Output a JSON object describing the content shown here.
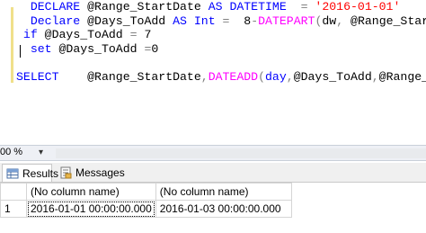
{
  "editor": {
    "lines": [
      [
        {
          "c": "pl",
          "t": "  "
        },
        {
          "c": "kw",
          "t": "DECLARE"
        },
        {
          "c": "pl",
          "t": " @Range_StartDate "
        },
        {
          "c": "kw",
          "t": "AS"
        },
        {
          "c": "pl",
          "t": " "
        },
        {
          "c": "kw",
          "t": "DATETIME"
        },
        {
          "c": "pl",
          "t": "  "
        },
        {
          "c": "op",
          "t": "="
        },
        {
          "c": "pl",
          "t": " "
        },
        {
          "c": "str",
          "t": "'2016-01-01'"
        }
      ],
      [
        {
          "c": "pl",
          "t": "  "
        },
        {
          "c": "kw",
          "t": "Declare"
        },
        {
          "c": "pl",
          "t": " @Days_ToAdd "
        },
        {
          "c": "kw",
          "t": "AS"
        },
        {
          "c": "pl",
          "t": " "
        },
        {
          "c": "kw",
          "t": "Int"
        },
        {
          "c": "pl",
          "t": " "
        },
        {
          "c": "op",
          "t": "="
        },
        {
          "c": "pl",
          "t": "  8"
        },
        {
          "c": "op",
          "t": "-"
        },
        {
          "c": "fn",
          "t": "DATEPART"
        },
        {
          "c": "op",
          "t": "("
        },
        {
          "c": "pl",
          "t": "dw"
        },
        {
          "c": "op",
          "t": ","
        },
        {
          "c": "pl",
          "t": " @Range_StartDate"
        },
        {
          "c": "op",
          "t": ")"
        }
      ],
      [
        {
          "c": "pl",
          "t": " "
        },
        {
          "c": "kw",
          "t": "if"
        },
        {
          "c": "pl",
          "t": " @Days_ToAdd "
        },
        {
          "c": "op",
          "t": "="
        },
        {
          "c": "pl",
          "t": " 7"
        }
      ],
      [
        {
          "c": "pl",
          "t": "  "
        },
        {
          "c": "kw",
          "t": "set"
        },
        {
          "c": "pl",
          "t": " @Days_ToAdd "
        },
        {
          "c": "op",
          "t": "="
        },
        {
          "c": "pl",
          "t": "0"
        }
      ],
      [
        {
          "c": "pl",
          "t": ""
        }
      ],
      [
        {
          "c": "kw",
          "t": "SELECT"
        },
        {
          "c": "pl",
          "t": "    @Range_StartDate"
        },
        {
          "c": "op",
          "t": ","
        },
        {
          "c": "fn",
          "t": "DATEADD"
        },
        {
          "c": "op",
          "t": "("
        },
        {
          "c": "kw",
          "t": "day"
        },
        {
          "c": "op",
          "t": ","
        },
        {
          "c": "pl",
          "t": "@Days_ToAdd"
        },
        {
          "c": "op",
          "t": ","
        },
        {
          "c": "pl",
          "t": "@Range_StartDate"
        },
        {
          "c": "op",
          "t": ")"
        }
      ]
    ]
  },
  "zoom": {
    "label": "00 %",
    "dropdown_icon": "chevron-down-icon"
  },
  "tabs": {
    "results_label": "Results",
    "messages_label": "Messages",
    "results_icon": "grid-icon",
    "messages_icon": "messages-icon"
  },
  "grid": {
    "headers": [
      "(No column name)",
      "(No column name)"
    ],
    "rows": [
      {
        "num": "1",
        "cells": [
          "2016-01-01 00:00:00.000",
          "2016-01-03 00:00:00.000"
        ]
      }
    ]
  }
}
